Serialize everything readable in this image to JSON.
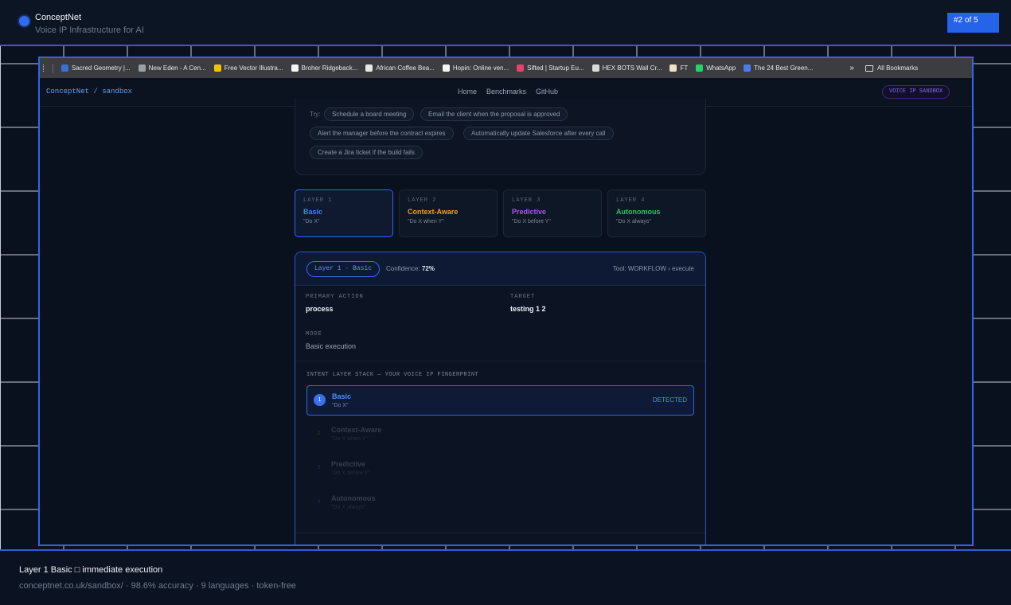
{
  "header": {
    "title": "ConceptNet",
    "subtitle": "Voice IP Infrastructure for AI",
    "counter": "#2 of 5"
  },
  "bookmarks": [
    {
      "label": "Sacred Geometry |...",
      "icon": "wordpress-icon",
      "color": "#3b6fd6"
    },
    {
      "label": "New Eden - A Cen...",
      "icon": "eye-icon",
      "color": "#9aa0a6"
    },
    {
      "label": "Free Vector Illustra...",
      "icon": "vector-icon",
      "color": "#f2c400"
    },
    {
      "label": "Broher Ridgeback...",
      "icon": "p-icon",
      "color": "#f5f5f5"
    },
    {
      "label": "African Coffee Bea...",
      "icon": "cup-icon",
      "color": "#e8e8e8"
    },
    {
      "label": "Hopin: Online ven...",
      "icon": "h-icon",
      "color": "#f5f5f5"
    },
    {
      "label": "Sifted | Startup Eu...",
      "icon": "sifted-icon",
      "color": "#e8416b"
    },
    {
      "label": "HEX BOTS Wall Cr...",
      "icon": "globe-icon",
      "color": "#d9d9d9"
    },
    {
      "label": "FT",
      "icon": "ft-icon",
      "color": "#f2dfc4"
    },
    {
      "label": "WhatsApp",
      "icon": "whatsapp-icon",
      "color": "#25d366"
    },
    {
      "label": "The 24 Best Green...",
      "icon": "infinity-icon",
      "color": "#4a7cf0"
    }
  ],
  "bookmarks_more": "»",
  "bookmarks_all": "All Bookmarks",
  "site": {
    "brand": "ConceptNet / sandbox",
    "nav": [
      "Home",
      "Benchmarks",
      "GitHub"
    ],
    "badge": "VOICE IP SANDBOX"
  },
  "try": {
    "label": "Try:",
    "chips": [
      "Schedule a board meeting",
      "Email the client when the proposal is approved",
      "Alert the manager before the contract expires",
      "Automatically update Salesforce after every call",
      "Create a Jira ticket if the build fails"
    ]
  },
  "layers": [
    {
      "num": "LAYER 1",
      "name": "Basic",
      "desc": "\"Do X\"",
      "color": "#3b82f6"
    },
    {
      "num": "LAYER 2",
      "name": "Context-Aware",
      "desc": "\"Do X when Y\"",
      "color": "#f59e0b"
    },
    {
      "num": "LAYER 3",
      "name": "Predictive",
      "desc": "\"Do X before Y\"",
      "color": "#a855f7"
    },
    {
      "num": "LAYER 4",
      "name": "Autonomous",
      "desc": "\"Do X always\"",
      "color": "#22c55e"
    }
  ],
  "result": {
    "pill": "Layer 1 · Basic",
    "confidence_label": "Confidence:",
    "confidence_value": "72%",
    "tool": "Tool: WORKFLOW › execute",
    "primary_action_label": "PRIMARY ACTION",
    "primary_action": "process",
    "target_label": "TARGET",
    "target": "testing 1 2",
    "mode_label": "MODE",
    "mode": "Basic execution",
    "stack_title": "INTENT LAYER STACK — YOUR VOICE IP FINGERPRINT",
    "stack": [
      {
        "num": "1",
        "name": "Basic",
        "desc": "\"Do X\"",
        "status": "DETECTED",
        "color": "#3b82f6"
      },
      {
        "num": "2",
        "name": "Context-Aware",
        "desc": "\"Do X when Y\"",
        "status": "",
        "color": "#f59e0b"
      },
      {
        "num": "3",
        "name": "Predictive",
        "desc": "\"Do X before Y\"",
        "status": "",
        "color": "#a855f7"
      },
      {
        "num": "4",
        "name": "Autonomous",
        "desc": "\"Do X always\"",
        "status": "",
        "color": "#22c55e"
      }
    ]
  },
  "caption": {
    "title": "Layer 1 Basic □ immediate execution",
    "sub": "conceptnet.co.uk/sandbox/ · 98.6% accuracy · 9 languages · token-free"
  }
}
